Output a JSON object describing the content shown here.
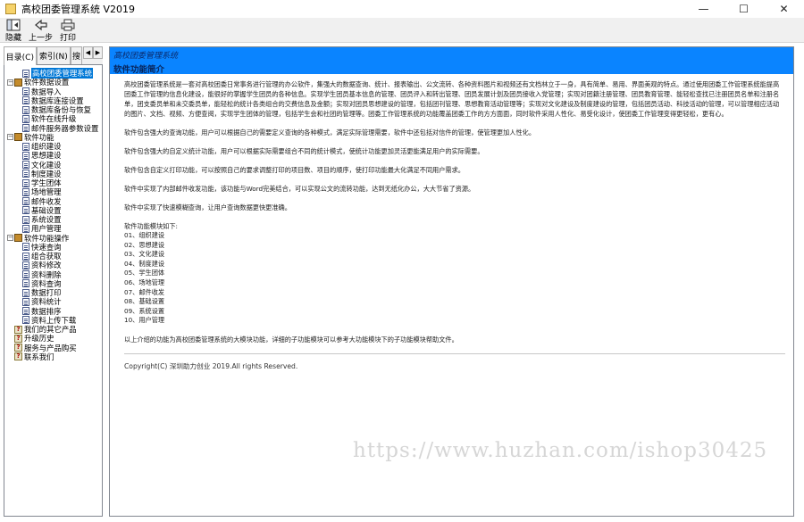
{
  "window": {
    "title": "高校团委管理系统 V2019",
    "minimize": "—",
    "maximize": "☐",
    "close": "✕"
  },
  "toolbar": {
    "hide_label": "隐藏",
    "back_label": "上一步",
    "print_label": "打印"
  },
  "tabs": {
    "contents": "目录(C)",
    "index": "索引(N)",
    "search": "搜"
  },
  "tree": [
    {
      "label": "高校团委管理系统",
      "level": 1,
      "icon": "page",
      "selected": true
    },
    {
      "label": "软件数据设置",
      "level": 0,
      "icon": "book",
      "expander": "−"
    },
    {
      "label": "数据导入",
      "level": 1,
      "icon": "page"
    },
    {
      "label": "数据库连接设置",
      "level": 1,
      "icon": "page"
    },
    {
      "label": "数据库备份与恢复",
      "level": 1,
      "icon": "page"
    },
    {
      "label": "软件在线升级",
      "level": 1,
      "icon": "page"
    },
    {
      "label": "邮件服务器参数设置",
      "level": 1,
      "icon": "page"
    },
    {
      "label": "软件功能",
      "level": 0,
      "icon": "book",
      "expander": "−"
    },
    {
      "label": "组织建设",
      "level": 1,
      "icon": "page"
    },
    {
      "label": "思想建设",
      "level": 1,
      "icon": "page"
    },
    {
      "label": "文化建设",
      "level": 1,
      "icon": "page"
    },
    {
      "label": "制度建设",
      "level": 1,
      "icon": "page"
    },
    {
      "label": "学生团体",
      "level": 1,
      "icon": "page"
    },
    {
      "label": "场地管理",
      "level": 1,
      "icon": "page"
    },
    {
      "label": "邮件收发",
      "level": 1,
      "icon": "page"
    },
    {
      "label": "基础设置",
      "level": 1,
      "icon": "page"
    },
    {
      "label": "系统设置",
      "level": 1,
      "icon": "page"
    },
    {
      "label": "用户管理",
      "level": 1,
      "icon": "page"
    },
    {
      "label": "软件功能操作",
      "level": 0,
      "icon": "book",
      "expander": "−"
    },
    {
      "label": "快速查询",
      "level": 1,
      "icon": "page"
    },
    {
      "label": "组合获取",
      "level": 1,
      "icon": "page"
    },
    {
      "label": "资料修改",
      "level": 1,
      "icon": "page"
    },
    {
      "label": "资料删除",
      "level": 1,
      "icon": "page"
    },
    {
      "label": "资料查询",
      "level": 1,
      "icon": "page"
    },
    {
      "label": "数据打印",
      "level": 1,
      "icon": "page"
    },
    {
      "label": "资料统计",
      "level": 1,
      "icon": "page"
    },
    {
      "label": "数据排序",
      "level": 1,
      "icon": "page"
    },
    {
      "label": "资料上传下载",
      "level": 1,
      "icon": "page"
    },
    {
      "label": "我们的其它产品",
      "level": 0,
      "icon": "q"
    },
    {
      "label": "升级历史",
      "level": 0,
      "icon": "q"
    },
    {
      "label": "服务与产品购买",
      "level": 0,
      "icon": "q"
    },
    {
      "label": "联系我们",
      "level": 0,
      "icon": "q"
    }
  ],
  "content": {
    "header_sub": "高校团委管理系统",
    "header_title": "软件功能简介",
    "paragraphs": [
      "高校团委管理系统是一套对高校团委日常事务进行管理的办公软件，集强大的数据查询、统计、报表输出、公文流转、各种资料图片和视频还有文档林立于一身，具有简单、易用、界面美观的特点。通过使用团委工作管理系统能提高团委工作管理的信息化建设，能很好的掌握学生团员的各种信息。实现学生团员基本信息的管理、团员评入和转出管理、团员发展计划及团员接收入党管理；实现对团籍注册管理、团员教育管理、能轻松查找已注册团员名单和注册名单，团支委员单和未交委员单，能轻松的统计各类组合的交费信息及金额；实现对团员思想建设的管理，包括团刊管理、思想教育活动管理等；实现对文化建设及制度建设的管理，包括团员活动、科技活动的管理，可以管理相应活动的图片、文档、视频、方便查阅，实现学生团体的管理，包括学生会和社团的管理等。团委工作管理系统的功能覆盖团委工作的方方面面，同时软件采用人性化、易受化设计，使团委工作管理变得更轻松，更有心。",
      "软件包含强大的查询功能，用户可以根据自己的需要定义查询的各种模式，满足实际管理需要，软件中还包括对信件的管理，使管理更加人性化。",
      "软件包含强大的自定义统计功能，用户可以根据实际需要组合不同的统计模式，使统计功能更加灵活更能满足用户的实际需要。",
      "软件包含自定义打印功能，可以按照自己的要求调整打印的项目数、项目的顺序，使打印功能最大化满足不同用户需求。",
      "软件中实现了内部邮件收发功能，该功能与Word完美结合，可以实现公文的流转功能，达到无纸化办公，大大节省了资源。",
      "软件中实现了快速模糊查询，让用户查询数据更快更准确。"
    ],
    "modules_title": "软件功能模块如下:",
    "modules": [
      "01、组织建设",
      "02、思想建设",
      "03、文化建设",
      "04、制度建设",
      "05、学生团体",
      "06、场地管理",
      "07、邮件收发",
      "08、基础设置",
      "09、系统设置",
      "10、用户管理"
    ],
    "closing": "以上介绍的功能为高校团委管理系统的大模块功能，详细的子功能模块可以参考大功能模块下的子功能模块帮助文件。",
    "copyright": "Copyright(C) 深圳助力创业 2019.All rights Reserved."
  },
  "watermark": "https://www.huzhan.com/ishop30425"
}
